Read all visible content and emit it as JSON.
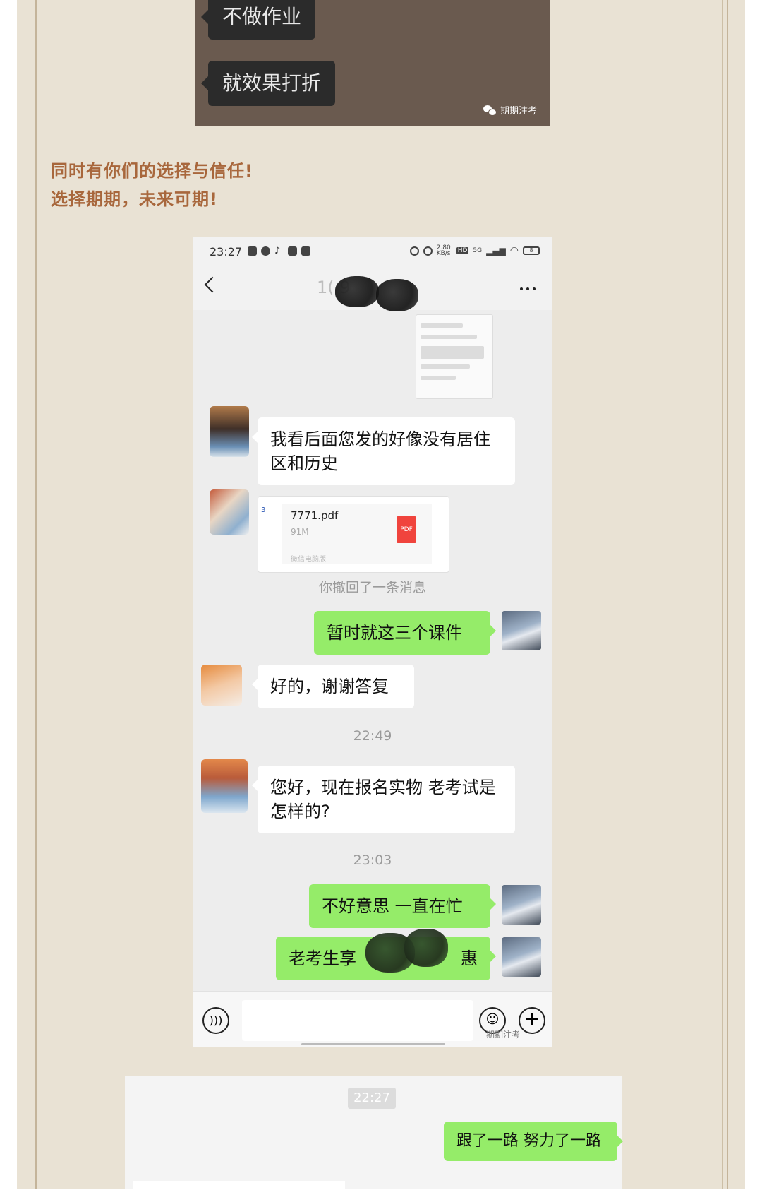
{
  "top_image": {
    "bubble_1": "不做作业",
    "bubble_2": "就效果打折",
    "watermark": "期期注考"
  },
  "caption": {
    "line_1": "同时有你们的选择与信任!",
    "line_2": "选择期期，未来可期!"
  },
  "phone": {
    "status_time": "23:27",
    "net_speed": "2.80 KB/s",
    "network": "5G",
    "battery": "8",
    "chat_title": "1(        9",
    "messages": {
      "m1": "我看后面您发的好像没有居住区和历史",
      "file_name": "7771.pdf",
      "file_size": "91M",
      "file_source": "微信电脑版",
      "pdf_label": "PDF",
      "recalled": "你撤回了一条消息",
      "m2": "暂时就这三个课件",
      "m3": "好的，谢谢答复",
      "time_1": "22:49",
      "m4": "您好，现在报名实物 老考试是怎样的?",
      "time_2": "23:03",
      "m5": "不好意思 一直在忙",
      "m6": "老考生享",
      "m6_end": "惠"
    },
    "watermark": "期期注考"
  },
  "bottom_chat": {
    "time": "22:27",
    "m1": "跟了一路 努力了一路"
  },
  "colors": {
    "page_bg": "#e9e2d4",
    "caption": "#a8673c",
    "green_bubble": "#95ec69"
  }
}
